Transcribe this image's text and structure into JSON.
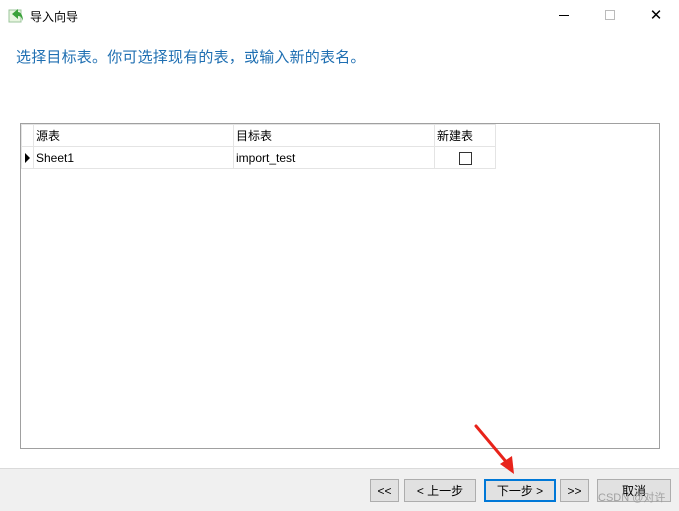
{
  "window": {
    "title": "导入向导",
    "close_glyph": "✕"
  },
  "instruction": "选择目标表。你可选择现有的表，或输入新的表名。",
  "grid": {
    "headers": [
      "源表",
      "目标表",
      "新建表"
    ],
    "rows": [
      {
        "source": "Sheet1",
        "target": "import_test",
        "new_table": false
      }
    ]
  },
  "buttons": {
    "first": "<<",
    "prev": "< 上一步",
    "next": "下一步 >",
    "last": ">>",
    "cancel": "取消"
  },
  "watermark": "CSDN @对许",
  "colors": {
    "instruction": "#1f6fb2",
    "annotation_arrow": "#e8231a",
    "app_icon": "#3aa23a"
  }
}
